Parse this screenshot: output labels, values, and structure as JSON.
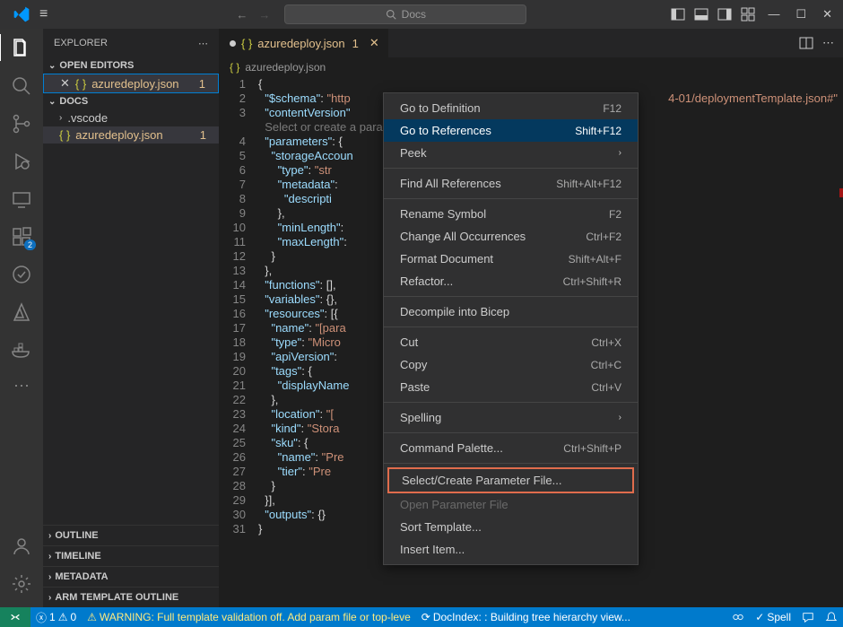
{
  "titlebar": {
    "search_placeholder": "Docs"
  },
  "sidebar": {
    "title": "EXPLORER",
    "sections": {
      "open_editors": "OPEN EDITORS",
      "docs": "DOCS",
      "outline": "OUTLINE",
      "timeline": "TIMELINE",
      "metadata": "METADATA",
      "arm": "ARM TEMPLATE OUTLINE"
    },
    "editor_file": "azuredeploy.json",
    "editor_badge": "1",
    "folder_vscode": ".vscode",
    "docs_file": "azuredeploy.json",
    "docs_file_badge": "1"
  },
  "tabs": {
    "active": "azuredeploy.json",
    "active_badge": "1"
  },
  "breadcrumb": {
    "file": "azuredeploy.json"
  },
  "code": {
    "lines": [
      {
        "n": "1",
        "indent": 0,
        "content": [
          {
            "t": "brace",
            "v": "{"
          }
        ]
      },
      {
        "n": "2",
        "indent": 1,
        "content": [
          {
            "t": "key",
            "v": "\"$schema\""
          },
          {
            "t": "brace",
            "v": ": "
          },
          {
            "t": "str",
            "v": "\"http"
          }
        ],
        "tail": {
          "t": "str",
          "v": "4-01/deploymentTemplate.json#\""
        }
      },
      {
        "n": "3",
        "indent": 1,
        "content": [
          {
            "t": "key",
            "v": "\"contentVersion\""
          }
        ]
      },
      {
        "n": "",
        "indent": 1,
        "content": [
          {
            "t": "hint",
            "v": "Select or create a param"
          }
        ]
      },
      {
        "n": "4",
        "indent": 1,
        "content": [
          {
            "t": "key",
            "v": "\"parameters\""
          },
          {
            "t": "brace",
            "v": ": {"
          }
        ]
      },
      {
        "n": "5",
        "indent": 2,
        "content": [
          {
            "t": "key",
            "v": "\"storageAccoun"
          }
        ]
      },
      {
        "n": "6",
        "indent": 3,
        "content": [
          {
            "t": "key",
            "v": "\"type\""
          },
          {
            "t": "brace",
            "v": ": "
          },
          {
            "t": "str",
            "v": "\"str"
          }
        ]
      },
      {
        "n": "7",
        "indent": 3,
        "content": [
          {
            "t": "key",
            "v": "\"metadata\""
          },
          {
            "t": "brace",
            "v": ": "
          }
        ]
      },
      {
        "n": "8",
        "indent": 4,
        "content": [
          {
            "t": "key",
            "v": "\"descripti"
          }
        ]
      },
      {
        "n": "9",
        "indent": 3,
        "content": [
          {
            "t": "brace",
            "v": "},"
          }
        ]
      },
      {
        "n": "10",
        "indent": 3,
        "content": [
          {
            "t": "key",
            "v": "\"minLength\""
          },
          {
            "t": "brace",
            "v": ":"
          }
        ]
      },
      {
        "n": "11",
        "indent": 3,
        "content": [
          {
            "t": "key",
            "v": "\"maxLength\""
          },
          {
            "t": "brace",
            "v": ":"
          }
        ]
      },
      {
        "n": "12",
        "indent": 2,
        "content": [
          {
            "t": "brace",
            "v": "}"
          }
        ]
      },
      {
        "n": "13",
        "indent": 1,
        "content": [
          {
            "t": "brace",
            "v": "},"
          }
        ]
      },
      {
        "n": "14",
        "indent": 1,
        "content": [
          {
            "t": "key",
            "v": "\"functions\""
          },
          {
            "t": "brace",
            "v": ": [],"
          }
        ]
      },
      {
        "n": "15",
        "indent": 1,
        "content": [
          {
            "t": "key",
            "v": "\"variables\""
          },
          {
            "t": "brace",
            "v": ": {},"
          }
        ]
      },
      {
        "n": "16",
        "indent": 1,
        "content": [
          {
            "t": "key",
            "v": "\"resources\""
          },
          {
            "t": "brace",
            "v": ": [{"
          }
        ]
      },
      {
        "n": "17",
        "indent": 2,
        "content": [
          {
            "t": "key",
            "v": "\"name\""
          },
          {
            "t": "brace",
            "v": ": "
          },
          {
            "t": "str",
            "v": "\"[para"
          }
        ]
      },
      {
        "n": "18",
        "indent": 2,
        "content": [
          {
            "t": "key",
            "v": "\"type\""
          },
          {
            "t": "brace",
            "v": ": "
          },
          {
            "t": "str",
            "v": "\"Micro"
          }
        ]
      },
      {
        "n": "19",
        "indent": 2,
        "content": [
          {
            "t": "key",
            "v": "\"apiVersion\""
          },
          {
            "t": "brace",
            "v": ":"
          }
        ]
      },
      {
        "n": "20",
        "indent": 2,
        "content": [
          {
            "t": "key",
            "v": "\"tags\""
          },
          {
            "t": "brace",
            "v": ": {"
          }
        ]
      },
      {
        "n": "21",
        "indent": 3,
        "content": [
          {
            "t": "key",
            "v": "\"displayName"
          }
        ]
      },
      {
        "n": "22",
        "indent": 2,
        "content": [
          {
            "t": "brace",
            "v": "},"
          }
        ]
      },
      {
        "n": "23",
        "indent": 2,
        "content": [
          {
            "t": "key",
            "v": "\"location\""
          },
          {
            "t": "brace",
            "v": ": "
          },
          {
            "t": "str",
            "v": "\"["
          }
        ]
      },
      {
        "n": "24",
        "indent": 2,
        "content": [
          {
            "t": "key",
            "v": "\"kind\""
          },
          {
            "t": "brace",
            "v": ": "
          },
          {
            "t": "str",
            "v": "\"Stora"
          }
        ]
      },
      {
        "n": "25",
        "indent": 2,
        "content": [
          {
            "t": "key",
            "v": "\"sku\""
          },
          {
            "t": "brace",
            "v": ": {"
          }
        ]
      },
      {
        "n": "26",
        "indent": 3,
        "content": [
          {
            "t": "key",
            "v": "\"name\""
          },
          {
            "t": "brace",
            "v": ": "
          },
          {
            "t": "str",
            "v": "\"Pre"
          }
        ]
      },
      {
        "n": "27",
        "indent": 3,
        "content": [
          {
            "t": "key",
            "v": "\"tier\""
          },
          {
            "t": "brace",
            "v": ": "
          },
          {
            "t": "str",
            "v": "\"Pre"
          }
        ]
      },
      {
        "n": "28",
        "indent": 2,
        "content": [
          {
            "t": "brace",
            "v": "}"
          }
        ]
      },
      {
        "n": "29",
        "indent": 1,
        "content": [
          {
            "t": "brace",
            "v": "}],"
          }
        ]
      },
      {
        "n": "30",
        "indent": 1,
        "content": [
          {
            "t": "key",
            "v": "\"outputs\""
          },
          {
            "t": "brace",
            "v": ": {}"
          }
        ]
      },
      {
        "n": "31",
        "indent": 0,
        "content": [
          {
            "t": "brace",
            "v": "}"
          }
        ]
      }
    ]
  },
  "context_menu": {
    "items": [
      {
        "label": "Go to Definition",
        "shortcut": "F12"
      },
      {
        "label": "Go to References",
        "shortcut": "Shift+F12",
        "highlighted": true
      },
      {
        "label": "Peek",
        "submenu": true
      },
      {
        "sep": true
      },
      {
        "label": "Find All References",
        "shortcut": "Shift+Alt+F12"
      },
      {
        "sep": true
      },
      {
        "label": "Rename Symbol",
        "shortcut": "F2"
      },
      {
        "label": "Change All Occurrences",
        "shortcut": "Ctrl+F2"
      },
      {
        "label": "Format Document",
        "shortcut": "Shift+Alt+F"
      },
      {
        "label": "Refactor...",
        "shortcut": "Ctrl+Shift+R"
      },
      {
        "sep": true
      },
      {
        "label": "Decompile into Bicep"
      },
      {
        "sep": true
      },
      {
        "label": "Cut",
        "shortcut": "Ctrl+X"
      },
      {
        "label": "Copy",
        "shortcut": "Ctrl+C"
      },
      {
        "label": "Paste",
        "shortcut": "Ctrl+V"
      },
      {
        "sep": true
      },
      {
        "label": "Spelling",
        "submenu": true
      },
      {
        "sep": true
      },
      {
        "label": "Command Palette...",
        "shortcut": "Ctrl+Shift+P"
      },
      {
        "sep": true
      },
      {
        "label": "Select/Create Parameter File...",
        "outlined": true
      },
      {
        "label": "Open Parameter File",
        "disabled": true
      },
      {
        "label": "Sort Template..."
      },
      {
        "label": "Insert Item..."
      }
    ]
  },
  "statusbar": {
    "errors": "1",
    "warnings": "0",
    "warning_text": "WARNING: Full template validation off. Add param file or top-leve",
    "docindex": "DocIndex: : Building tree hierarchy view...",
    "spell": "Spell"
  }
}
